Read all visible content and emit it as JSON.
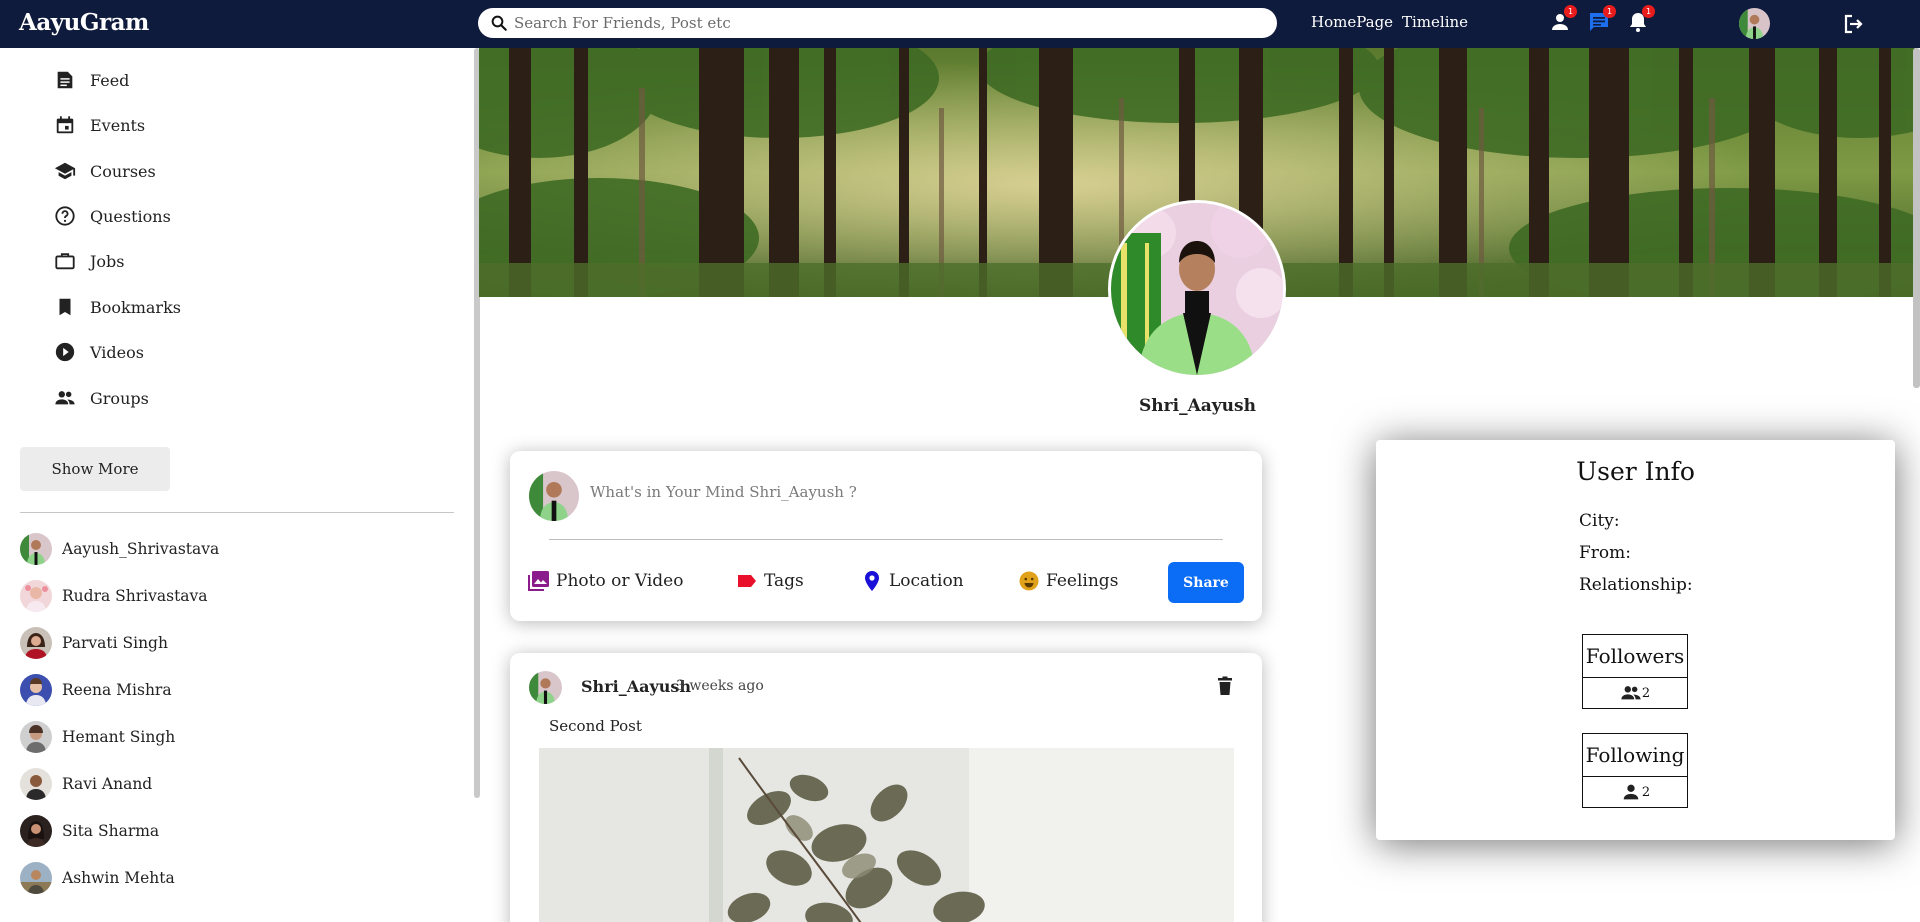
{
  "app": {
    "logo": "AayuGram"
  },
  "topbar": {
    "search_placeholder": "Search For Friends, Post etc",
    "links": [
      "HomePage",
      "Timeline"
    ],
    "badges": {
      "friends": "1",
      "messages": "1",
      "notifications": "1"
    }
  },
  "sidebar": {
    "items": [
      {
        "label": "Feed",
        "icon": "feed-icon"
      },
      {
        "label": "Events",
        "icon": "calendar-icon"
      },
      {
        "label": "Courses",
        "icon": "school-icon"
      },
      {
        "label": "Questions",
        "icon": "help-icon"
      },
      {
        "label": "Jobs",
        "icon": "briefcase-icon"
      },
      {
        "label": "Bookmarks",
        "icon": "bookmark-icon"
      },
      {
        "label": "Videos",
        "icon": "play-icon"
      },
      {
        "label": "Groups",
        "icon": "group-icon"
      }
    ],
    "show_more": "Show More",
    "friends": [
      "Aayush_Shrivastava",
      "Rudra Shrivastava",
      "Parvati Singh",
      "Reena Mishra",
      "Hemant Singh",
      "Ravi Anand",
      "Sita Sharma",
      "Ashwin Mehta"
    ]
  },
  "profile": {
    "name": "Shri_Aayush"
  },
  "share": {
    "placeholder": "What's in Your Mind Shri_Aayush ?",
    "options": [
      "Photo or Video",
      "Tags",
      "Location",
      "Feelings"
    ],
    "button": "Share",
    "colors": {
      "photo": "#8b1c8b",
      "tags": "#e8102a",
      "location": "#1a10d8",
      "feelings": "#e0a21a",
      "button": "#0b6cf5"
    }
  },
  "post": {
    "user": "Shri_Aayush",
    "time": "3 weeks ago",
    "text": "Second Post"
  },
  "user_info": {
    "title": "User Info",
    "city_label": "City:",
    "from_label": "From:",
    "relationship_label": "Relationship:",
    "followers_label": "Followers",
    "followers_count": "2",
    "following_label": "Following",
    "following_count": "2"
  },
  "colors": {
    "topbar": "#0f1b3d",
    "badge": "#e81c1c"
  }
}
